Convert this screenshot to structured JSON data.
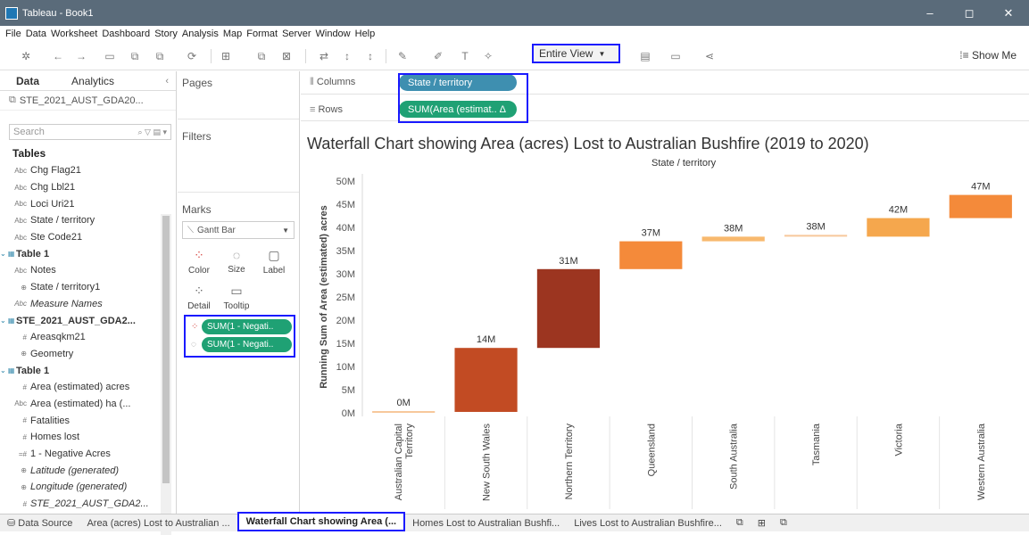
{
  "window": {
    "title": "Tableau - Book1"
  },
  "menu": [
    "File",
    "Data",
    "Worksheet",
    "Dashboard",
    "Story",
    "Analysis",
    "Map",
    "Format",
    "Server",
    "Window",
    "Help"
  ],
  "toolbar": {
    "fit_label": "Entire View",
    "show_me_label": "Show Me"
  },
  "data_pane": {
    "tabs": [
      "Data",
      "Analytics"
    ],
    "datasource": "STE_2021_AUST_GDA20...",
    "search_placeholder": "Search",
    "tables_heading": "Tables",
    "fields": [
      {
        "label": "Chg Flag21",
        "icon": "Abc",
        "kind": "dim"
      },
      {
        "label": "Chg Lbl21",
        "icon": "Abc",
        "kind": "dim"
      },
      {
        "label": "Loci Uri21",
        "icon": "Abc",
        "kind": "dim"
      },
      {
        "label": "State / territory",
        "icon": "Abc",
        "kind": "dim"
      },
      {
        "label": "Ste Code21",
        "icon": "Abc",
        "kind": "dim"
      },
      {
        "label": "Table 1",
        "icon": "⌄ ▦",
        "kind": "header"
      },
      {
        "label": "Notes",
        "icon": "Abc",
        "kind": "dim"
      },
      {
        "label": "State / territory1",
        "icon": "⊕",
        "kind": "dim"
      },
      {
        "label": "Measure Names",
        "icon": "Abc",
        "kind": "italic"
      },
      {
        "label": "STE_2021_AUST_GDA2...",
        "icon": "⌄ ▦",
        "kind": "header"
      },
      {
        "label": "Areasqkm21",
        "icon": "#",
        "kind": "measure"
      },
      {
        "label": "Geometry",
        "icon": "⊕",
        "kind": "measure"
      },
      {
        "label": "Table 1",
        "icon": "⌄ ▦",
        "kind": "header"
      },
      {
        "label": "Area (estimated) acres",
        "icon": "#",
        "kind": "measure"
      },
      {
        "label": "Area (estimated) ha (...",
        "icon": "Abc",
        "kind": "measure"
      },
      {
        "label": "Fatalities",
        "icon": "#",
        "kind": "measure"
      },
      {
        "label": "Homes lost",
        "icon": "#",
        "kind": "measure"
      },
      {
        "label": "1 - Negative Acres",
        "icon": "=#",
        "kind": "measure"
      },
      {
        "label": "Latitude (generated)",
        "icon": "⊕",
        "kind": "italic"
      },
      {
        "label": "Longitude (generated)",
        "icon": "⊕",
        "kind": "italic"
      },
      {
        "label": "STE_2021_AUST_GDA2...",
        "icon": "#",
        "kind": "italic"
      }
    ]
  },
  "cards": {
    "pages": "Pages",
    "filters": "Filters",
    "marks": "Marks",
    "mark_type": "Gantt Bar",
    "mark_buttons": [
      "Color",
      "Size",
      "Label",
      "Detail",
      "Tooltip"
    ],
    "mark_pills": [
      "SUM(1 - Negati..",
      "SUM(1 - Negati.."
    ]
  },
  "shelves": {
    "columns_label": "Columns",
    "rows_label": "Rows",
    "columns_pill": "State / territory",
    "rows_pill": "SUM(Area (estimat.. Δ"
  },
  "chart_data": {
    "type": "bar",
    "subtype": "waterfall",
    "title": "Waterfall Chart showing Area (acres) Lost to Australian Bushfire (2019 to 2020)",
    "subtitle": "State / territory",
    "ylabel": "Running Sum of Area (estimated) acres",
    "ylim": [
      0,
      50
    ],
    "yticks": [
      "0M",
      "5M",
      "10M",
      "15M",
      "20M",
      "25M",
      "30M",
      "35M",
      "40M",
      "45M",
      "50M"
    ],
    "categories": [
      "Australian Capital Territory",
      "New South Wales",
      "Northern Territory",
      "Queensland",
      "South Australia",
      "Tasmania",
      "Victoria",
      "Western Australia"
    ],
    "running_totals_m": [
      0.2,
      14,
      31,
      37,
      38,
      38,
      42,
      47
    ],
    "bar_starts_m": [
      0,
      0.2,
      14,
      31,
      37,
      38,
      38,
      42
    ],
    "data_labels": [
      "0M",
      "14M",
      "31M",
      "37M",
      "38M",
      "38M",
      "42M",
      "47M"
    ],
    "colors": [
      "#f7c89b",
      "#c24b23",
      "#9c3520",
      "#f48a3a",
      "#f8b96e",
      "#f7c89b",
      "#f5a74d",
      "#f48a3a"
    ]
  },
  "sheet_tabs": [
    "Data Source",
    "Area (acres) Lost to Australian ...",
    "Waterfall Chart showing Area (...",
    "Homes Lost to Australian Bushfi...",
    "Lives Lost to Australian Bushfire..."
  ],
  "colors": {
    "pill_green": "#1fa174",
    "pill_blue": "#3e8fb0",
    "highlight": "#1a1aff"
  }
}
